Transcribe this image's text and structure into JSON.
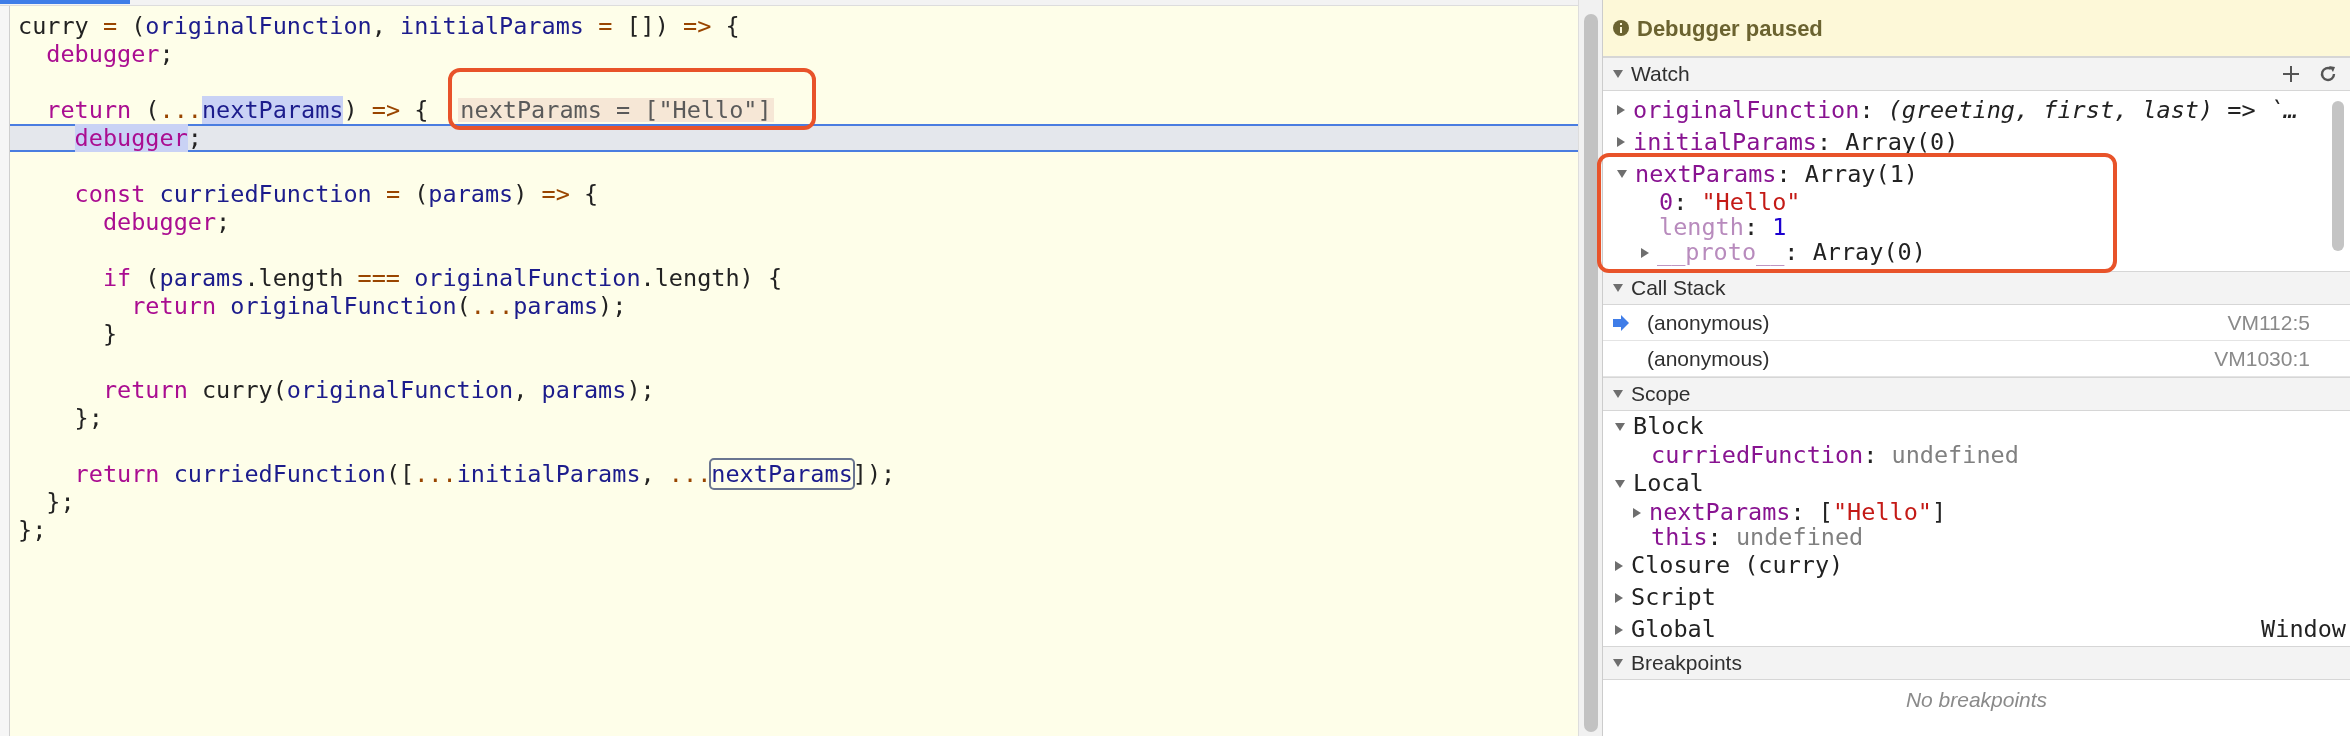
{
  "editor": {
    "lines": [
      {
        "current": false,
        "tokens": [
          {
            "kind": "plain",
            "text": "curry "
          },
          {
            "kind": "operator",
            "text": "="
          },
          {
            "kind": "plain",
            "text": " ("
          },
          {
            "kind": "name",
            "text": "originalFunction"
          },
          {
            "kind": "plain",
            "text": ", "
          },
          {
            "kind": "name",
            "text": "initialParams"
          },
          {
            "kind": "operator",
            "text": " ="
          },
          {
            "kind": "plain",
            "text": " []) "
          },
          {
            "kind": "operator",
            "text": "=>"
          },
          {
            "kind": "plain",
            "text": " {"
          }
        ]
      },
      {
        "current": false,
        "tokens": [
          {
            "kind": "keyword",
            "text": "  debugger"
          },
          {
            "kind": "plain",
            "text": ";"
          }
        ]
      },
      {
        "current": false
      },
      {
        "current": false,
        "tokens": [
          {
            "kind": "keyword",
            "text": "  return"
          },
          {
            "kind": "plain",
            "text": " ("
          },
          {
            "kind": "operator",
            "text": "..."
          },
          {
            "kind": "highlighted_name",
            "text": "nextParams"
          },
          {
            "kind": "plain",
            "text": ") "
          },
          {
            "kind": "operator",
            "text": "=>"
          },
          {
            "kind": "plain",
            "text": " {"
          }
        ],
        "inline_value": "nextParams = [\"Hello\"]"
      },
      {
        "current": true,
        "tokens": [
          {
            "kind": "highlighted_keyword",
            "text": "    debugger"
          },
          {
            "kind": "plain",
            "text": ";"
          }
        ]
      },
      {
        "current": false
      },
      {
        "current": false,
        "tokens": [
          {
            "kind": "keyword",
            "text": "    const"
          },
          {
            "kind": "name",
            "text": " curriedFunction"
          },
          {
            "kind": "operator",
            "text": " ="
          },
          {
            "kind": "plain",
            "text": " ("
          },
          {
            "kind": "name",
            "text": "params"
          },
          {
            "kind": "plain",
            "text": ") "
          },
          {
            "kind": "operator",
            "text": "=>"
          },
          {
            "kind": "plain",
            "text": " {"
          }
        ]
      },
      {
        "current": false,
        "tokens": [
          {
            "kind": "keyword",
            "text": "      debugger"
          },
          {
            "kind": "plain",
            "text": ";"
          }
        ]
      },
      {
        "current": false
      },
      {
        "current": false,
        "tokens": [
          {
            "kind": "keyword",
            "text": "      if"
          },
          {
            "kind": "plain",
            "text": " ("
          },
          {
            "kind": "name",
            "text": "params"
          },
          {
            "kind": "plain",
            "text": ".length "
          },
          {
            "kind": "operator",
            "text": "==="
          },
          {
            "kind": "name",
            "text": " originalFunction"
          },
          {
            "kind": "plain",
            "text": ".length) {"
          }
        ]
      },
      {
        "current": false,
        "tokens": [
          {
            "kind": "keyword",
            "text": "        return"
          },
          {
            "kind": "name",
            "text": " originalFunction"
          },
          {
            "kind": "plain",
            "text": "("
          },
          {
            "kind": "operator",
            "text": "..."
          },
          {
            "kind": "name",
            "text": "params"
          },
          {
            "kind": "plain",
            "text": ");"
          }
        ]
      },
      {
        "current": false,
        "tokens": [
          {
            "kind": "plain",
            "text": "      }"
          }
        ]
      },
      {
        "current": false
      },
      {
        "current": false,
        "tokens": [
          {
            "kind": "keyword",
            "text": "      return"
          },
          {
            "kind": "plain",
            "text": " curry("
          },
          {
            "kind": "name",
            "text": "originalFunction"
          },
          {
            "kind": "plain",
            "text": ", "
          },
          {
            "kind": "name",
            "text": "params"
          },
          {
            "kind": "plain",
            "text": ");"
          }
        ]
      },
      {
        "current": false,
        "tokens": [
          {
            "kind": "plain",
            "text": "    };"
          }
        ]
      },
      {
        "current": false
      },
      {
        "current": false,
        "tokens": [
          {
            "kind": "keyword",
            "text": "    return"
          },
          {
            "kind": "name",
            "text": " curriedFunction"
          },
          {
            "kind": "plain",
            "text": "(["
          },
          {
            "kind": "operator",
            "text": "..."
          },
          {
            "kind": "name",
            "text": "initialParams"
          },
          {
            "kind": "plain",
            "text": ", "
          },
          {
            "kind": "operator",
            "text": "..."
          },
          {
            "kind": "boxed_name",
            "text": "nextParams"
          },
          {
            "kind": "plain",
            "text": "]);"
          }
        ]
      },
      {
        "current": false,
        "tokens": [
          {
            "kind": "plain",
            "text": "  };"
          }
        ]
      },
      {
        "current": false,
        "tokens": [
          {
            "kind": "plain",
            "text": "};"
          }
        ]
      }
    ]
  },
  "debugger": {
    "banner": "Debugger paused",
    "sections": [
      {
        "kind": "watch",
        "title": "Watch",
        "expanded": true,
        "items": [
          {
            "name": "originalFunction",
            "inherited": false,
            "kind": "collapsed",
            "value": [
              {
                "kind": "plain",
                "text": ": "
              },
              {
                "kind": "function",
                "text": "(greeting, first, last) => `…"
              }
            ]
          },
          {
            "name": "initialParams",
            "inherited": false,
            "kind": "collapsed",
            "value": [
              {
                "kind": "plain",
                "text": ": Array(0)"
              }
            ]
          },
          {
            "name": "nextParams",
            "inherited": false,
            "kind": "expanded",
            "value": [
              {
                "kind": "plain",
                "text": ": Array(1)"
              }
            ],
            "children": [
              {
                "name": "0",
                "inherited": false,
                "kind": "leaf",
                "value": [
                  {
                    "kind": "plain",
                    "text": ": "
                  },
                  {
                    "kind": "string",
                    "text": "\"Hello\""
                  }
                ]
              },
              {
                "name": "length",
                "inherited": true,
                "kind": "leaf",
                "value": [
                  {
                    "kind": "plain",
                    "text": ": "
                  },
                  {
                    "kind": "number",
                    "text": "1"
                  }
                ]
              },
              {
                "name": "__proto__",
                "inherited": true,
                "kind": "collapsed",
                "value": [
                  {
                    "kind": "plain",
                    "text": ": Array(0)"
                  }
                ]
              }
            ]
          }
        ]
      },
      {
        "kind": "call_stack",
        "title": "Call Stack",
        "expanded": true,
        "frames": [
          {
            "name": "(anonymous)",
            "location": "VM112:5",
            "selected": true
          },
          {
            "name": "(anonymous)",
            "location": "VM1030:1",
            "selected": false
          }
        ]
      },
      {
        "kind": "scope",
        "title": "Scope",
        "expanded": true,
        "groups": [
          {
            "name": "Block",
            "kind": "expanded",
            "children": [
              {
                "name": "curriedFunction",
                "inherited": false,
                "kind": "leaf",
                "value": [
                  {
                    "kind": "plain",
                    "text": ": "
                  },
                  {
                    "kind": "undefined",
                    "text": "undefined"
                  }
                ]
              }
            ]
          },
          {
            "name": "Local",
            "kind": "expanded",
            "children": [
              {
                "name": "nextParams",
                "inherited": false,
                "kind": "collapsed",
                "value": [
                  {
                    "kind": "plain",
                    "text": ": ["
                  },
                  {
                    "kind": "string",
                    "text": "\"Hello\""
                  },
                  {
                    "kind": "plain",
                    "text": "]"
                  }
                ]
              },
              {
                "name": "this",
                "inherited": false,
                "kind": "leaf",
                "value": [
                  {
                    "kind": "plain",
                    "text": ": "
                  },
                  {
                    "kind": "undefined",
                    "text": "undefined"
                  }
                ]
              }
            ]
          },
          {
            "name": "Closure (curry)",
            "kind": "collapsed"
          },
          {
            "name": "Script",
            "kind": "collapsed"
          },
          {
            "name": "Global",
            "kind": "collapsed",
            "detail": "Window"
          }
        ]
      },
      {
        "kind": "breakpoints",
        "title": "Breakpoints",
        "expanded": true,
        "empty_text": "No breakpoints"
      }
    ]
  }
}
